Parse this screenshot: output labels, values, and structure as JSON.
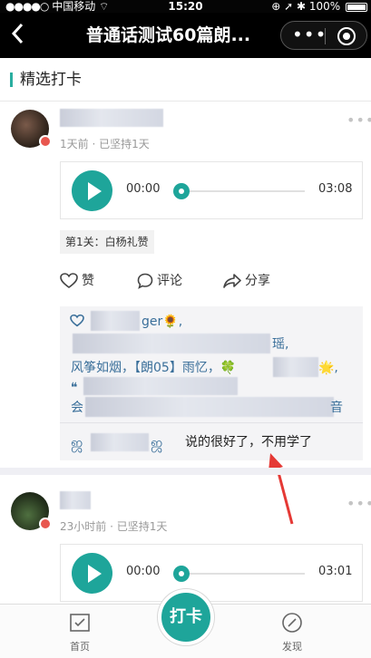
{
  "status_bar": {
    "signal": "●●●●○",
    "carrier": "中国移动",
    "wifi": "⌔",
    "time": "15:20",
    "battery_pct": "100%"
  },
  "nav": {
    "back_icon": "chevron-left",
    "title": "普通话测试60篇朗...",
    "more_label": "•••",
    "close_icon": "target-circle"
  },
  "section": {
    "title": "精选打卡",
    "accent_color": "#2aaea0"
  },
  "posts": [
    {
      "meta": "1天前 · 已坚持1天",
      "player": {
        "current": "00:00",
        "total": "03:08",
        "progress": 0
      },
      "tag": "第1关：白杨礼赞",
      "actions": {
        "like": "赞",
        "comment": "评论",
        "share": "分享"
      },
      "comments": {
        "line1_suffix": "ger🌻,",
        "line2_suffix": "瑶,",
        "line3": "风筝如烟，【朗05】雨忆，🍀",
        "line3_end": "🌟,",
        "line4_prefix": "❝",
        "line5_prefix": "会",
        "line5_suffix": "音",
        "reply": "说的很好了，不用学了"
      }
    },
    {
      "meta": "23小时前 · 已坚持1天",
      "player": {
        "current": "00:00",
        "total": "03:01",
        "progress": 0
      }
    }
  ],
  "tab_bar": {
    "home_label": "首页",
    "checkin_label": "打卡",
    "discover_label": "发现",
    "brand_color": "#1ea59a"
  }
}
